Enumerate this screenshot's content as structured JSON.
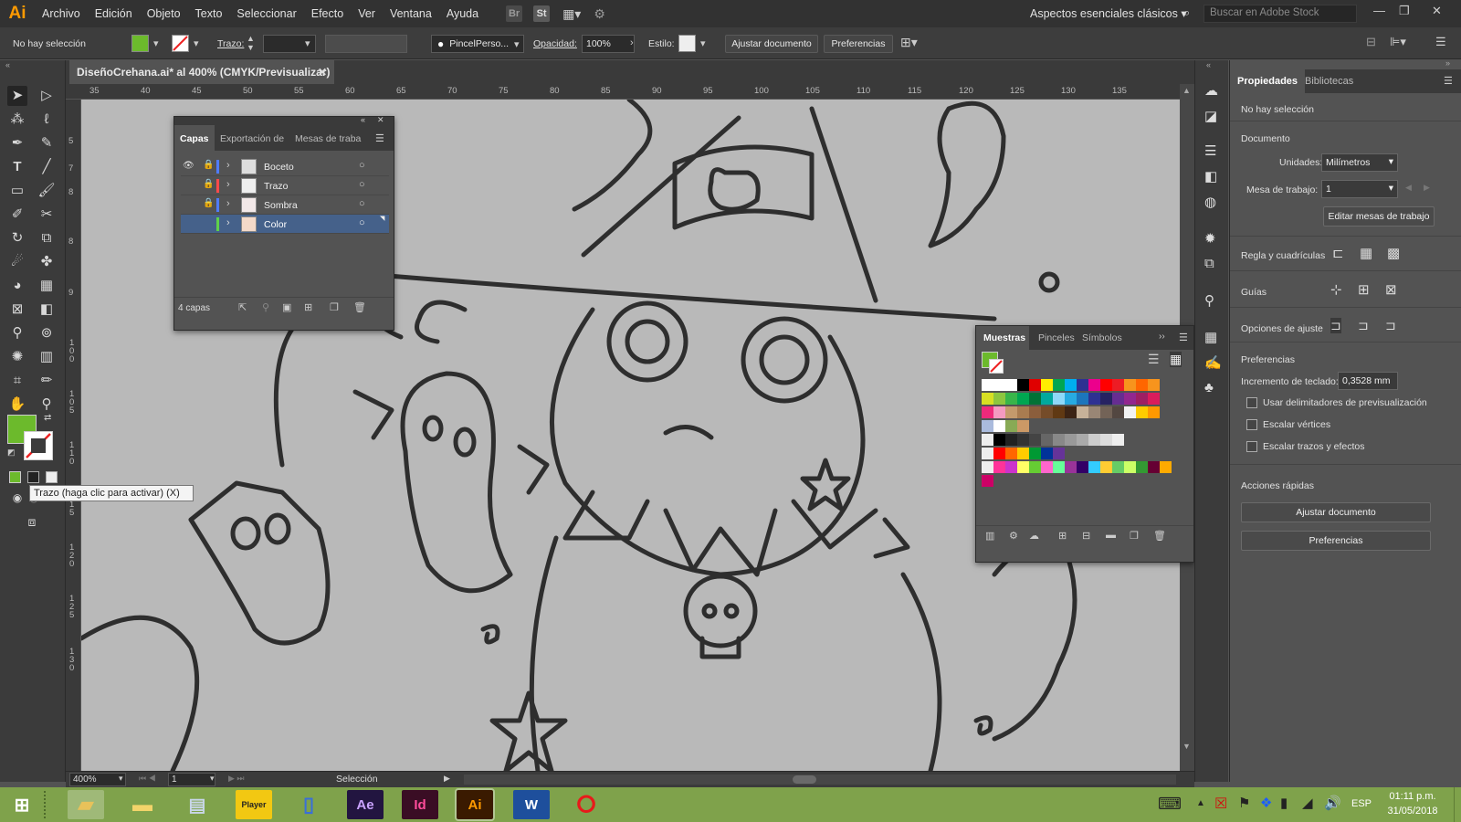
{
  "menubar": {
    "logo": "Ai",
    "items": [
      "Archivo",
      "Edición",
      "Objeto",
      "Texto",
      "Seleccionar",
      "Efecto",
      "Ver",
      "Ventana",
      "Ayuda"
    ],
    "bridge": "Br",
    "stock": "St",
    "workspace": "Aspectos esenciales clásicos",
    "search_placeholder": "Buscar en Adobe Stock"
  },
  "control": {
    "selection": "No hay selección",
    "stroke_label": "Trazo:",
    "brush": "PincelPerso...",
    "opacity_label": "Opacidad:",
    "opacity_value": "100%",
    "style_label": "Estilo:",
    "fit_doc": "Ajustar documento",
    "prefs": "Preferencias",
    "fill_color": "#6cba2c"
  },
  "document": {
    "tab_title": "DiseñoCrehana.ai* al 400% (CMYK/Previsualizar)",
    "ruler_top": [
      "35",
      "40",
      "45",
      "50",
      "55",
      "60",
      "65",
      "70",
      "75",
      "80",
      "85",
      "90",
      "95",
      "100",
      "105",
      "110",
      "115",
      "120",
      "125",
      "130",
      "135"
    ],
    "ruler_left": [
      "5",
      "7",
      "8",
      "8",
      "9",
      "1 0 0",
      "1 0 5",
      "1 1 0",
      "1 1 5",
      "1 2 0",
      "1 2 5",
      "1 3 0"
    ]
  },
  "status": {
    "zoom": "400%",
    "artboard": "1",
    "tool": "Selección"
  },
  "layers": {
    "tabs": [
      "Capas",
      "Exportación de",
      "Mesas de traba"
    ],
    "rows": [
      {
        "name": "Boceto",
        "color": "#4f7cff"
      },
      {
        "name": "Trazo",
        "color": "#ff4a4a"
      },
      {
        "name": "Sombra",
        "color": "#4f7cff"
      },
      {
        "name": "Color",
        "color": "#5fd04a"
      }
    ],
    "count": "4 capas"
  },
  "swatches": {
    "tabs": [
      "Muestras",
      "Pinceles",
      "Símbolos"
    ]
  },
  "tooltip": "Trazo (haga clic para activar) (X)",
  "properties": {
    "tabs": [
      "Propiedades",
      "Bibliotecas"
    ],
    "no_selection": "No hay selección",
    "document_heading": "Documento",
    "units_label": "Unidades:",
    "units_value": "Milímetros",
    "artboard_label": "Mesa de trabajo:",
    "artboard_value": "1",
    "edit_artboards": "Editar mesas de trabajo",
    "rulers_label": "Regla y cuadrículas",
    "guides_label": "Guías",
    "snap_label": "Opciones de ajuste",
    "prefs_heading": "Preferencias",
    "keyboard_label": "Incremento de teclado:",
    "keyboard_value": "0,3528 mm",
    "checkboxes": [
      "Usar delimitadores de previsualización",
      "Escalar vértices",
      "Escalar trazos y efectos"
    ],
    "quick_actions": "Acciones rápidas",
    "fit_doc": "Ajustar documento",
    "prefs": "Preferencias"
  },
  "taskbar": {
    "apps": [
      "Player",
      "Ae",
      "Id",
      "Ai",
      "W"
    ],
    "lang": "ESP",
    "time": "01:11 p.m.",
    "date": "31/05/2018"
  }
}
